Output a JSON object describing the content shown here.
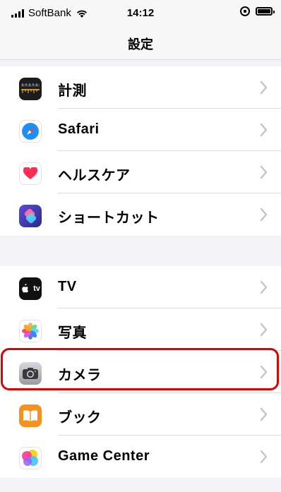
{
  "status": {
    "carrier": "SoftBank",
    "time": "14:12"
  },
  "nav": {
    "title": "設定"
  },
  "groups": [
    {
      "items": [
        {
          "label": "計測",
          "icon": "measure-icon"
        },
        {
          "label": "Safari",
          "icon": "safari-icon"
        },
        {
          "label": "ヘルスケア",
          "icon": "health-icon"
        },
        {
          "label": "ショートカット",
          "icon": "shortcuts-icon"
        }
      ]
    },
    {
      "items": [
        {
          "label": "TV",
          "icon": "apple-tv-icon",
          "icon_text": "tv"
        },
        {
          "label": "写真",
          "icon": "photos-icon"
        },
        {
          "label": "カメラ",
          "icon": "camera-icon",
          "highlighted": true
        },
        {
          "label": "ブック",
          "icon": "books-icon"
        },
        {
          "label": "Game Center",
          "icon": "game-center-icon"
        }
      ]
    }
  ],
  "colors": {
    "highlight": "#e00000",
    "chevron": "#c4c4c7",
    "safari": "#1b8ff5",
    "shortcuts": "#4a3fd0",
    "books": "#f5921e"
  }
}
